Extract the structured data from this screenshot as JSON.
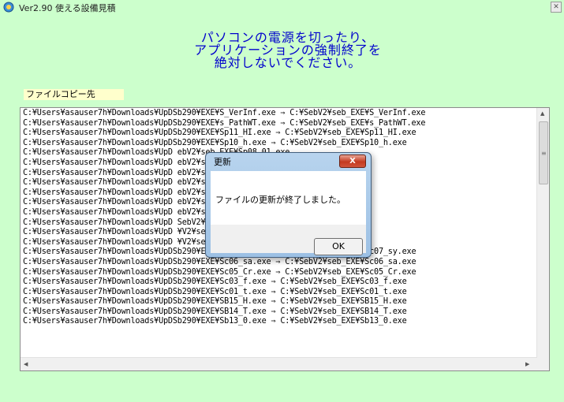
{
  "window": {
    "title": "Ver2.90 使える設備見積",
    "close_icon": "close-x-icon"
  },
  "warning": {
    "text": "パソコンの電源を切ったり、\nアプリケーションの強制終了を\n絶対しないでください。",
    "color": "#0000cc"
  },
  "copy_label": "ファイルコピー先",
  "list": {
    "lines": [
      "C:¥Users¥asauser7h¥Downloads¥UpDSb290¥EXE¥S_VerInf.exe ⇒ C:¥SebV2¥seb_EXE¥S_VerInf.exe",
      "C:¥Users¥asauser7h¥Downloads¥UpDSb290¥EXE¥s_PathWT.exe ⇒ C:¥SebV2¥seb_EXE¥s_PathWT.exe",
      "C:¥Users¥asauser7h¥Downloads¥UpDSb290¥EXE¥Sp11_HI.exe ⇒ C:¥SebV2¥seb_EXE¥Sp11_HI.exe",
      "C:¥Users¥asauser7h¥Downloads¥UpDSb290¥EXE¥Sp10_h.exe ⇒ C:¥SebV2¥seb_EXE¥Sp10_h.exe",
      "C:¥Users¥asauser7h¥Downloads¥UpD                                ebV2¥seb_EXE¥Sp08_01.exe",
      "C:¥Users¥asauser7h¥Downloads¥UpD                                ebV2¥seb_EXE¥Sp07_01.exe",
      "C:¥Users¥asauser7h¥Downloads¥UpD                                ebV2¥seb_EXE¥Sp06_01.exe",
      "C:¥Users¥asauser7h¥Downloads¥UpD                                ebV2¥seb_EXE¥SP05_01.exe",
      "C:¥Users¥asauser7h¥Downloads¥UpD                                ebV2¥seb_EXE¥Sp03_01.exe",
      "C:¥Users¥asauser7h¥Downloads¥UpD                                ebV2¥seb_EXE¥Sp01_01.exe",
      "C:¥Users¥asauser7h¥Downloads¥UpD                                ebV2¥seb_EXE¥SihanCvS.exe",
      "C:¥Users¥asauser7h¥Downloads¥UpD                                SebV2¥seb_EXE¥seb_open.exe",
      "C:¥Users¥asauser7h¥Downloads¥UpD                                ¥V2¥seb_EXE¥Sc99_f.exe",
      "C:¥Users¥asauser7h¥Downloads¥UpD                                ¥V2¥seb_EXE¥SC10_L.exe",
      "C:¥Users¥asauser7h¥Downloads¥UpDSb290¥EXE¥Sc07_sy.exe ⇒ C:¥SebV2¥seb_EXE¥Sc07_sy.exe",
      "C:¥Users¥asauser7h¥Downloads¥UpDSb290¥EXE¥Sc06_sa.exe ⇒ C:¥SebV2¥seb_EXE¥Sc06_sa.exe",
      "C:¥Users¥asauser7h¥Downloads¥UpDSb290¥EXE¥Sc05_Cr.exe ⇒ C:¥SebV2¥seb_EXE¥Sc05_Cr.exe",
      "C:¥Users¥asauser7h¥Downloads¥UpDSb290¥EXE¥Sc03_f.exe ⇒ C:¥SebV2¥seb_EXE¥Sc03_f.exe",
      "C:¥Users¥asauser7h¥Downloads¥UpDSb290¥EXE¥Sc01_t.exe ⇒ C:¥SebV2¥seb_EXE¥Sc01_t.exe",
      "C:¥Users¥asauser7h¥Downloads¥UpDSb290¥EXE¥SB15_H.exe ⇒ C:¥SebV2¥seb_EXE¥SB15_H.exe",
      "C:¥Users¥asauser7h¥Downloads¥UpDSb290¥EXE¥SB14_T.exe ⇒ C:¥SebV2¥seb_EXE¥SB14_T.exe",
      "C:¥Users¥asauser7h¥Downloads¥UpDSb290¥EXE¥Sb13_0.exe ⇒ C:¥SebV2¥seb_EXE¥Sb13_0.exe"
    ]
  },
  "dialog": {
    "title": "更新",
    "close_label": "X",
    "message": "ファイルの更新が終了しました。",
    "ok_label": "OK"
  }
}
